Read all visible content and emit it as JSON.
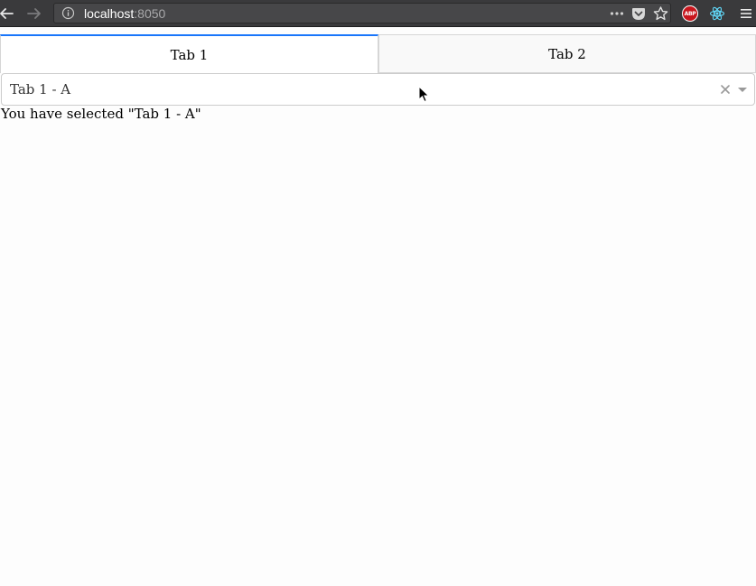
{
  "browser": {
    "url_host": "localhost",
    "url_port": ":8050",
    "extensions": [
      {
        "name": "adblock-plus",
        "label": "ABP"
      },
      {
        "name": "react-devtools"
      }
    ],
    "colors": {
      "toolbar": "#3a3a3c",
      "urlbar": "#474749",
      "abp": "#c8161d",
      "react": "#61dafb"
    }
  },
  "tabs": [
    {
      "label": "Tab 1",
      "selected": true
    },
    {
      "label": "Tab 2",
      "selected": false
    }
  ],
  "dropdown": {
    "value": "Tab 1 - A",
    "clearable": true
  },
  "output": {
    "text": "You have selected \"Tab 1 - A\""
  },
  "accent_color": "#1975fa"
}
